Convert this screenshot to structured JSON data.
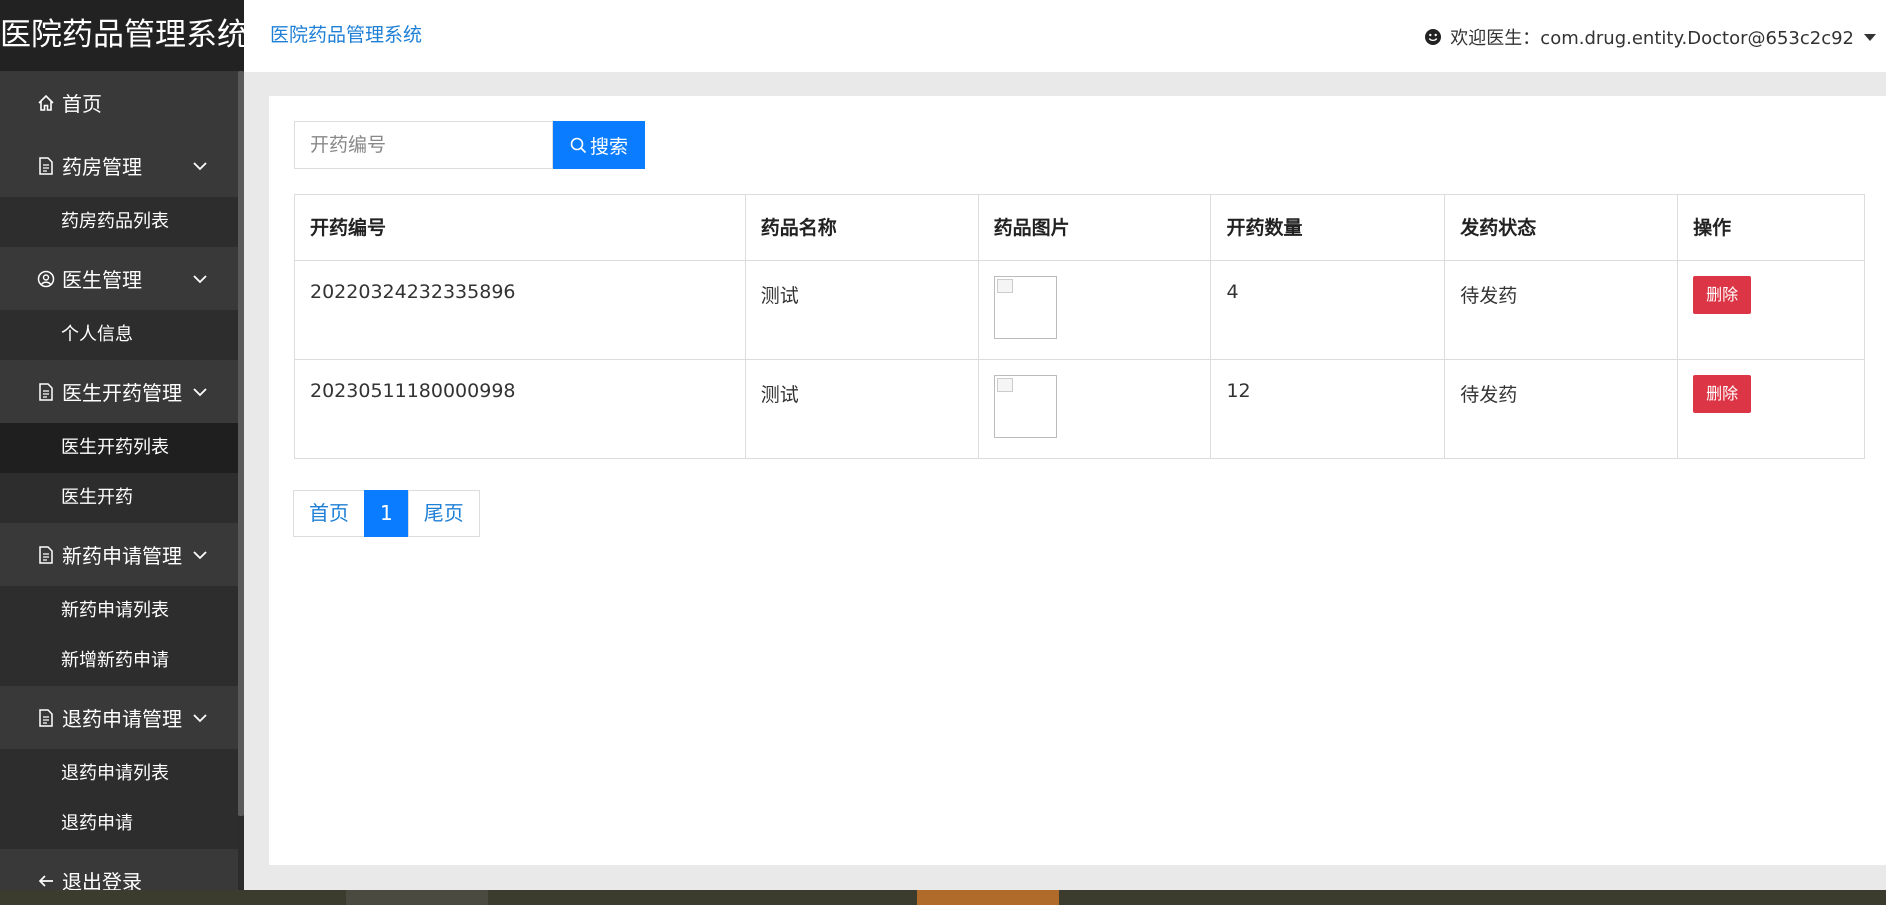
{
  "brand": "医院药品管理系统",
  "header": {
    "title": "医院药品管理系统",
    "user_text": "欢迎医生：com.drug.entity.Doctor@653c2c92"
  },
  "sidebar": {
    "items": [
      {
        "label": "首页",
        "icon": "home-icon"
      },
      {
        "label": "药房管理",
        "icon": "document-icon",
        "subs": [
          "药房药品列表"
        ]
      },
      {
        "label": "医生管理",
        "icon": "user-circle-icon",
        "subs": [
          "个人信息"
        ]
      },
      {
        "label": "医生开药管理",
        "icon": "document-icon",
        "subs": [
          "医生开药列表",
          "医生开药"
        ]
      },
      {
        "label": "新药申请管理",
        "icon": "document-icon",
        "subs": [
          "新药申请列表",
          "新增新药申请"
        ]
      },
      {
        "label": "退药申请管理",
        "icon": "document-icon",
        "subs": [
          "退药申请列表",
          "退药申请"
        ]
      },
      {
        "label": "退出登录",
        "icon": "arrow-left-icon"
      }
    ],
    "active_sub": "医生开药列表"
  },
  "search": {
    "placeholder": "开药编号",
    "button_label": "搜索"
  },
  "table": {
    "headers": [
      "开药编号",
      "药品名称",
      "药品图片",
      "开药数量",
      "发药状态",
      "操作"
    ],
    "rows": [
      {
        "code": "20220324232335896",
        "name": "测试",
        "qty": "4",
        "status": "待发药",
        "action": "删除"
      },
      {
        "code": "20230511180000998",
        "name": "测试",
        "qty": "12",
        "status": "待发药",
        "action": "删除"
      }
    ]
  },
  "pager": {
    "first": "首页",
    "current": "1",
    "last": "尾页"
  },
  "colors": {
    "sidebar_bg": "#393939",
    "brand_bg": "#222222",
    "accent": "#0a7cff",
    "link": "#1e7fd6",
    "danger": "#dc3545"
  }
}
